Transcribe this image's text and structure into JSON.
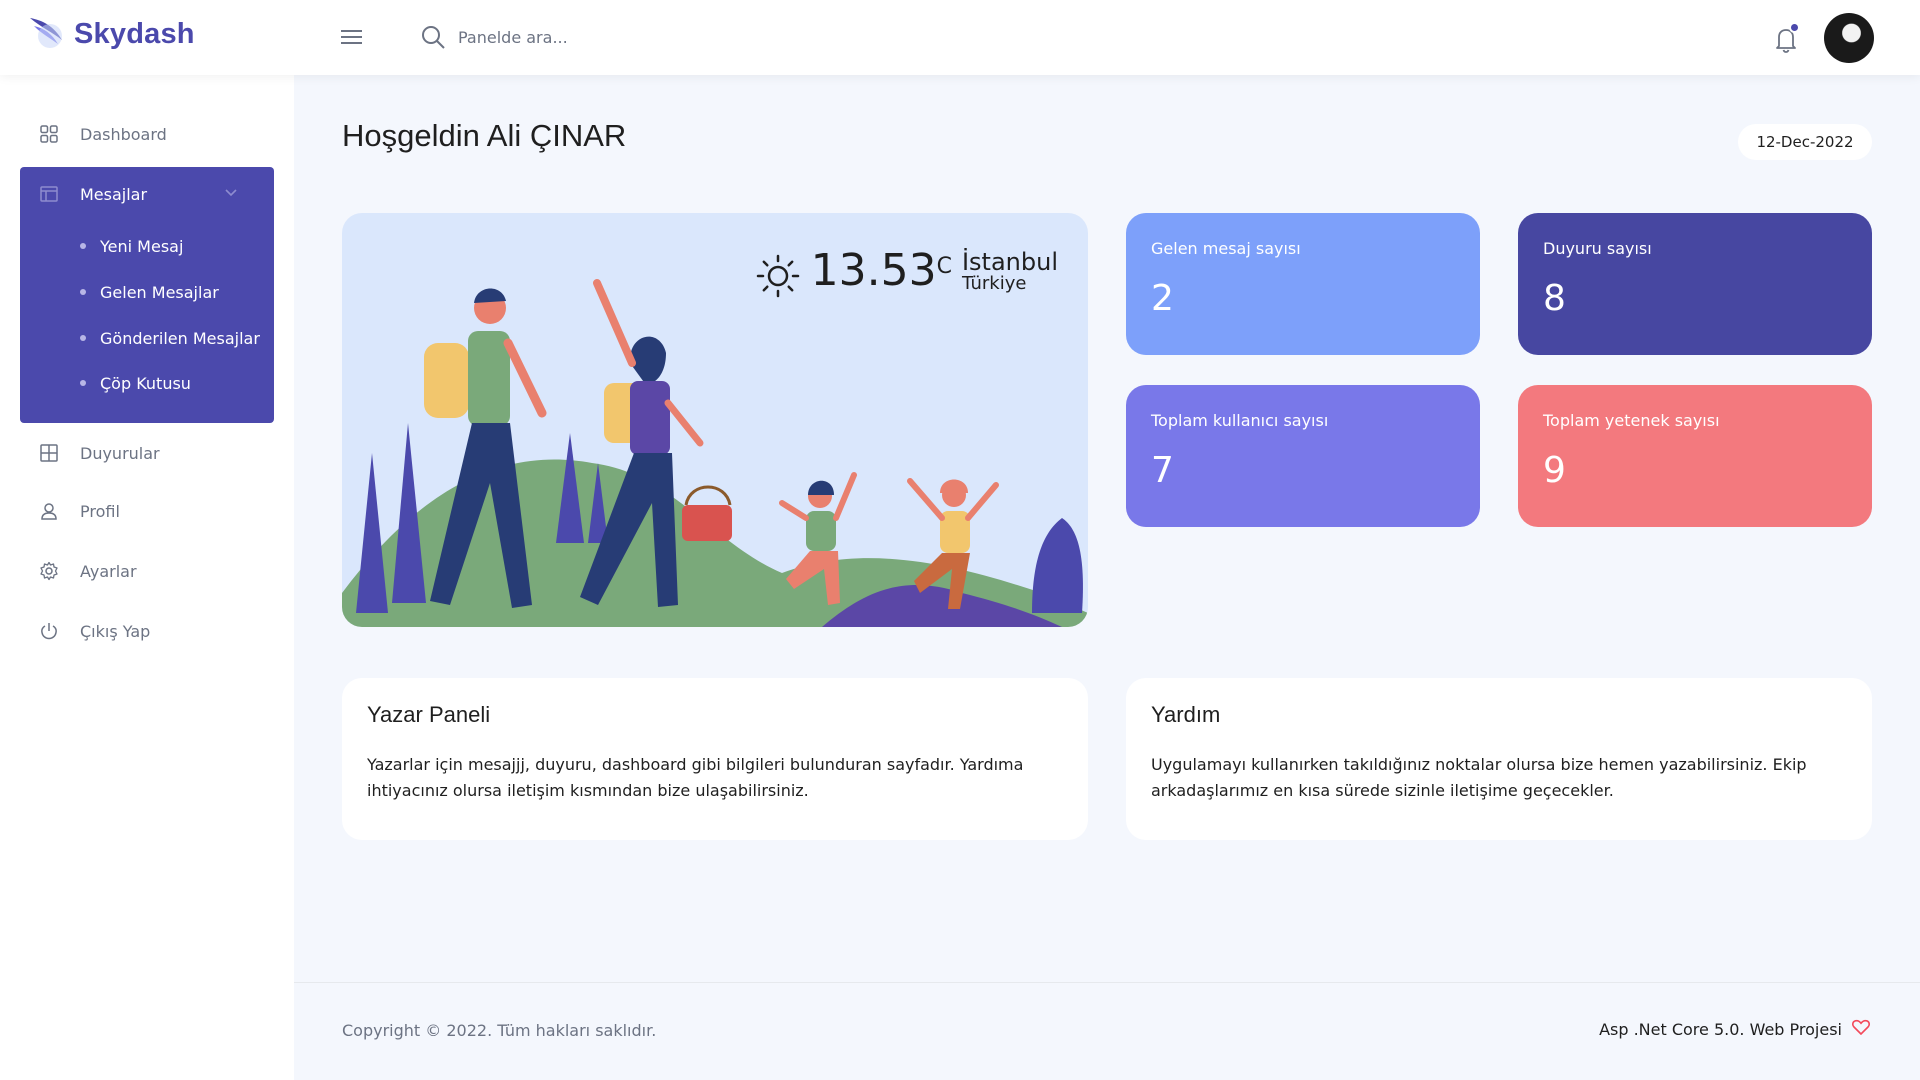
{
  "brand": {
    "name": "Skydash"
  },
  "search": {
    "placeholder": "Panelde ara..."
  },
  "sidebar": {
    "items": [
      {
        "label": "Dashboard",
        "icon": "grid-icon"
      },
      {
        "label": "Duyurular",
        "icon": "layout-icon"
      },
      {
        "label": "Profil",
        "icon": "user-icon"
      },
      {
        "label": "Ayarlar",
        "icon": "gear-icon"
      },
      {
        "label": "Çıkış Yap",
        "icon": "power-icon"
      }
    ],
    "submenu": {
      "label": "Mesajlar",
      "icon": "window-icon",
      "items": [
        "Yeni Mesaj",
        "Gelen Mesajlar",
        "Gönderilen Mesajlar",
        "Çöp Kutusu"
      ]
    }
  },
  "header": {
    "welcome": "Hoşgeldin Ali ÇINAR",
    "date": "12-Dec-2022"
  },
  "weather": {
    "temperature": "13.53",
    "unit": "C",
    "city": "İstanbul",
    "country": "Türkiye",
    "icon": "sun-icon"
  },
  "stats": [
    {
      "title": "Gelen mesaj sayısı",
      "value": "2",
      "color": "#7da0fa"
    },
    {
      "title": "Duyuru sayısı",
      "value": "8",
      "color": "#4747a1"
    },
    {
      "title": "Toplam kullanıcı sayısı",
      "value": "7",
      "color": "#7978e9"
    },
    {
      "title": "Toplam yetenek sayısı",
      "value": "9",
      "color": "#f3797e"
    }
  ],
  "cards": {
    "yazar": {
      "title": "Yazar Paneli",
      "text": "Yazarlar için mesajjj, duyuru, dashboard gibi bilgileri bulunduran sayfadır. Yardıma ihtiyacınız olursa iletişim kısmından bize ulaşabilirsiniz."
    },
    "yardim": {
      "title": "Yardım",
      "text": "Uygulamayı kullanırken takıldığınız noktalar olursa bize hemen yazabilirsiniz. Ekip arkadaşlarımız en kısa sürede sizinle iletişime geçecekler."
    }
  },
  "footer": {
    "copyright": "Copyright © 2022. Tüm hakları saklıdır.",
    "project": "Asp .Net Core 5.0. Web Projesi"
  },
  "colors": {
    "accent": "#4b49ac",
    "background": "#f4f7fd"
  }
}
